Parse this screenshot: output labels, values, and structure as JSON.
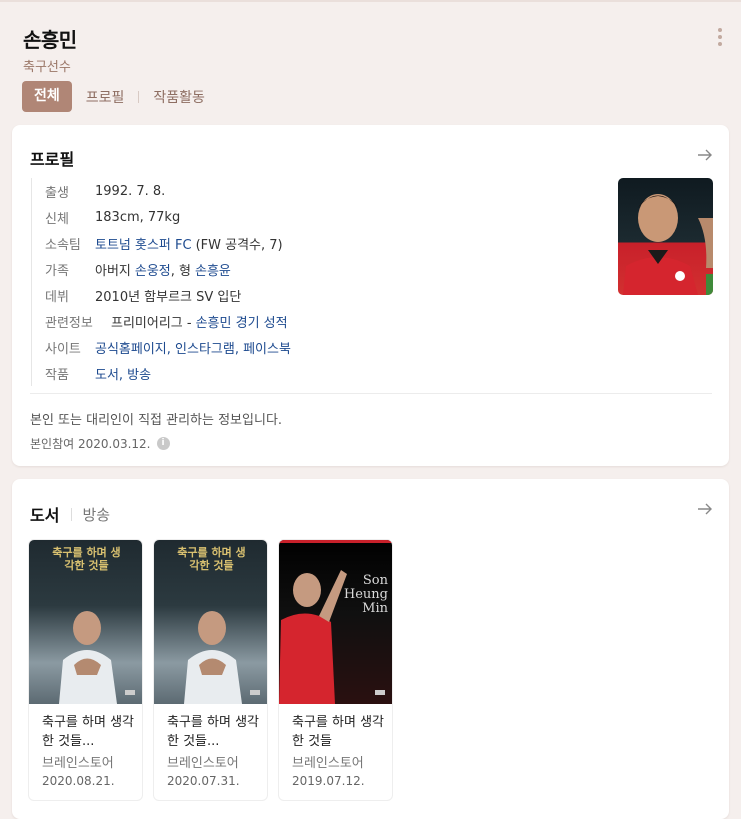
{
  "header": {
    "title": "손흥민",
    "subtitle": "축구선수",
    "tabs": [
      "전체",
      "프로필",
      "작품활동"
    ]
  },
  "profile": {
    "title": "프로필",
    "rows": {
      "birth": {
        "label": "출생",
        "value": "1992. 7. 8."
      },
      "body": {
        "label": "신체",
        "value": "183cm, 77kg"
      },
      "team": {
        "label": "소속팀",
        "link": "토트넘 홋스퍼 FC",
        "value": "(FW 공격수, 7)"
      },
      "family": {
        "label": "가족",
        "pre": "아버지",
        "link1": "손웅정",
        "mid": ", 형",
        "link2": "손흥윤"
      },
      "debut": {
        "label": "데뷔",
        "value": "2010년 함부르크 SV 입단"
      },
      "related": {
        "label": "관련정보",
        "pre": "프리미어리그 -",
        "link": "손흥민 경기 성적"
      },
      "site": {
        "label": "사이트",
        "links": "공식홈페이지, 인스타그램, 페이스북"
      },
      "works": {
        "label": "작품",
        "links": "도서, 방송"
      }
    },
    "note": "본인 또는 대리인이 직접 관리하는 정보입니다.",
    "participation": "본인참여 2020.03.12."
  },
  "books": {
    "tabs": [
      "도서",
      "방송"
    ],
    "items": [
      {
        "cover_title": "축구를 하며 생각한 것들",
        "title": "축구를 하며 생각한 것들...",
        "publisher": "브레인스토어",
        "date": "2020.08.21."
      },
      {
        "cover_title": "축구를 하며 생각한 것들",
        "title": "축구를 하며 생각한 것들...",
        "publisher": "브레인스토어",
        "date": "2020.07.31."
      },
      {
        "cover_title": "Son Heung Min",
        "title": "축구를 하며 생각한 것들",
        "publisher": "브레인스토어",
        "date": "2019.07.12."
      }
    ]
  },
  "colors": {
    "accent": "#b08676",
    "link": "#1d4a8f",
    "background": "#f5efed"
  }
}
